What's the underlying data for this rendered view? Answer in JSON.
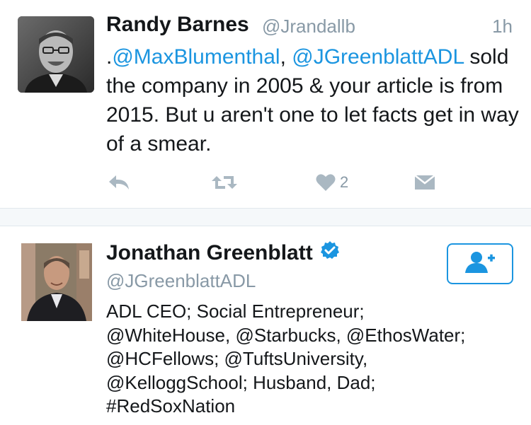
{
  "tweet": {
    "author_name": "Randy Barnes",
    "author_handle": "@Jrandallb",
    "time": "1h",
    "text_prefix": ".",
    "mention_1": "@MaxBlumenthal",
    "separator": ", ",
    "mention_2": "@JGreenblattADL",
    "text_body": " sold the company in 2005 & your article is from 2015. But u aren't one to let facts get in way of a smear.",
    "like_count": "2"
  },
  "profile": {
    "name": "Jonathan Greenblatt",
    "handle": "@JGreenblattADL",
    "verified": true,
    "bio_lines": [
      "ADL CEO; Social Entrepreneur;",
      "@WhiteHouse, @Starbucks, @EthosWater;",
      "@HCFellows; @TuftsUniversity,",
      "@KelloggSchool; Husband, Dad;",
      "#RedSoxNation"
    ]
  },
  "icons": {
    "reply": "reply-icon",
    "retweet": "retweet-icon",
    "like": "heart-icon",
    "dm": "envelope-icon",
    "follow": "add-user-icon",
    "verified": "verified-badge-icon"
  },
  "colors": {
    "link": "#1b95e0",
    "muted": "#8899a6",
    "text": "#14171a",
    "icon": "#aab8c2"
  }
}
